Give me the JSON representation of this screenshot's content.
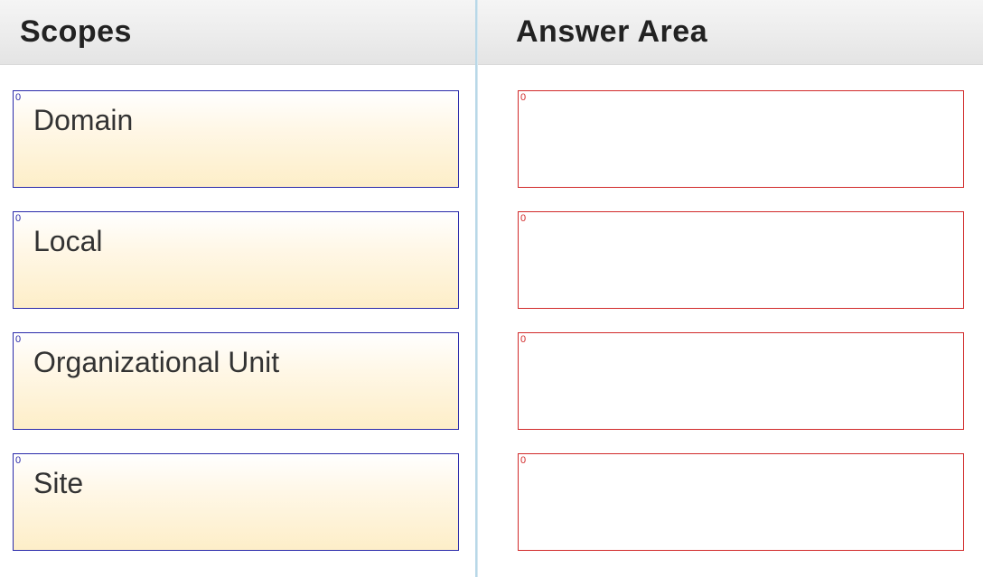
{
  "left": {
    "title": "Scopes",
    "items": [
      {
        "label": "Domain",
        "corner": "0"
      },
      {
        "label": "Local",
        "corner": "0"
      },
      {
        "label": "Organizational Unit",
        "corner": "0"
      },
      {
        "label": "Site",
        "corner": "0"
      }
    ]
  },
  "right": {
    "title": "Answer Area",
    "slots": [
      {
        "corner": "0"
      },
      {
        "corner": "0"
      },
      {
        "corner": "0"
      },
      {
        "corner": "0"
      }
    ]
  }
}
